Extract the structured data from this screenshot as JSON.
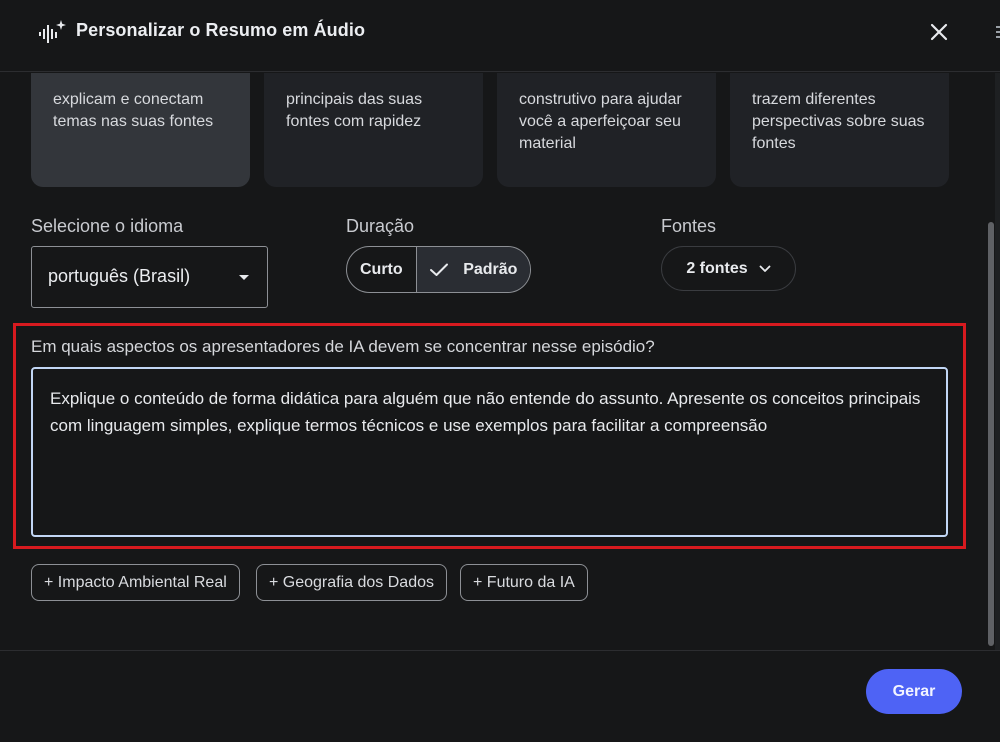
{
  "header": {
    "title": "Personalizar o Resumo em Áudio",
    "logo_icon": "audio-waveform-sparkle-icon",
    "close_icon": "close-icon"
  },
  "format_cards": [
    {
      "text": "explicam e conectam temas nas suas fontes",
      "selected": true
    },
    {
      "text": "principais das suas fontes com rapidez",
      "selected": false
    },
    {
      "text": "construtivo para ajudar você a aperfeiçoar seu material",
      "selected": false
    },
    {
      "text": "trazem diferentes perspectivas sobre suas fontes",
      "selected": false
    }
  ],
  "language": {
    "label": "Selecione o idioma",
    "value": "português (Brasil)"
  },
  "duration": {
    "label": "Duração",
    "options": [
      "Curto",
      "Padrão"
    ],
    "selected": "Padrão"
  },
  "sources": {
    "label": "Fontes",
    "button": "2 fontes"
  },
  "focus": {
    "label": "Em quais aspectos os apresentadores de IA devem se concentrar nesse episódio?",
    "value": "Explique o conteúdo de forma didática para alguém que não entende do assunto. Apresente os conceitos principais com linguagem simples, explique termos técnicos e use exemplos para facilitar a compreensão"
  },
  "suggestions": [
    "+ Impacto Ambiental Real",
    "+ Geografia dos Dados",
    "+ Futuro da IA"
  ],
  "footer": {
    "generate": "Gerar"
  },
  "colors": {
    "accent": "#4e63f5",
    "highlight_border": "#d71a1f"
  }
}
